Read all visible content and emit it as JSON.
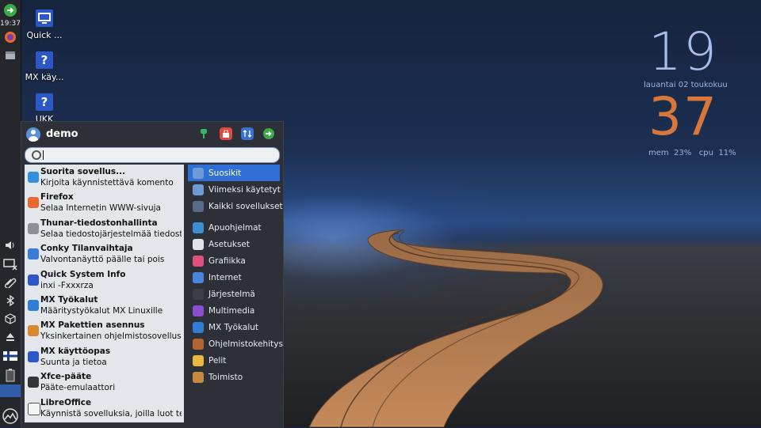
{
  "panel": {
    "clock": "19:37"
  },
  "desktop": {
    "icons": [
      {
        "label": "Quick ...",
        "glyph": "monitor-icon"
      },
      {
        "label": "MX käy...",
        "glyph": "help-icon"
      },
      {
        "label": "UKK",
        "glyph": "help-icon"
      }
    ]
  },
  "conky": {
    "hours": "19",
    "date": "lauantai  02 toukokuu",
    "minutes": "37",
    "mem_label": "mem",
    "mem_value": "23%",
    "cpu_label": "cpu",
    "cpu_value": "11%"
  },
  "menu": {
    "user": "demo",
    "search_value": "",
    "favorites": [
      {
        "title": "Suorita sovellus...",
        "desc": "Kirjoita käynnistettävä komento",
        "icon": "run-icon",
        "color": "#2f8fe0"
      },
      {
        "title": "Firefox",
        "desc": "Selaa Internetin WWW-sivuja",
        "icon": "firefox-icon",
        "color": "#e8692b"
      },
      {
        "title": "Thunar-tiedostonhallinta",
        "desc": "Selaa tiedostojärjestelmää tiedosto...",
        "icon": "file-manager-icon",
        "color": "#8a9096"
      },
      {
        "title": "Conky Tilanvaihtaja",
        "desc": "Valvontanäyttö päälle tai pois",
        "icon": "conky-icon",
        "color": "#3a7bd5"
      },
      {
        "title": "Quick System Info",
        "desc": "inxi -Fxxxrza",
        "icon": "system-info-icon",
        "color": "#2c57c7"
      },
      {
        "title": "MX Työkalut",
        "desc": "Määritystyökalut MX Linuxille",
        "icon": "mx-tools-icon",
        "color": "#2f7fd6"
      },
      {
        "title": "MX Pakettien asennus",
        "desc": "Yksinkertainen ohjelmistosovellusp...",
        "icon": "package-installer-icon",
        "color": "#d8892e"
      },
      {
        "title": "MX käyttöopas",
        "desc": "Suunta ja tietoa",
        "icon": "help-icon",
        "color": "#2c57c7"
      },
      {
        "title": "Xfce-pääte",
        "desc": "Pääte-emulaattori",
        "icon": "terminal-icon",
        "color": "#333639"
      },
      {
        "title": "LibreOffice",
        "desc": "Käynnistä sovelluksia, joilla luot tek...",
        "icon": "libreoffice-icon",
        "color": "#f4f4f4"
      }
    ],
    "categories_top": [
      {
        "label": "Suosikit",
        "icon": "folder-icon",
        "color": "#6e9bd8",
        "active": true
      },
      {
        "label": "Viimeksi käytetyt",
        "icon": "folder-icon",
        "color": "#6e9bd8",
        "active": false
      },
      {
        "label": "Kaikki sovellukset",
        "icon": "all-apps-icon",
        "color": "#5a6b8a",
        "active": false
      }
    ],
    "categories": [
      {
        "label": "Apuohjelmat",
        "icon": "accessories-icon",
        "color": "#3c8fd0"
      },
      {
        "label": "Asetukset",
        "icon": "settings-icon",
        "color": "#dfe3e8"
      },
      {
        "label": "Grafiikka",
        "icon": "graphics-icon",
        "color": "#e0507a"
      },
      {
        "label": "Internet",
        "icon": "internet-icon",
        "color": "#4a86e0"
      },
      {
        "label": "Järjestelmä",
        "icon": "system-icon",
        "color": "#3b3f45"
      },
      {
        "label": "Multimedia",
        "icon": "multimedia-icon",
        "color": "#8a4fd0"
      },
      {
        "label": "MX Työkalut",
        "icon": "mx-tools-icon",
        "color": "#2f7fd6"
      },
      {
        "label": "Ohjelmistokehitys",
        "icon": "development-icon",
        "color": "#b2652e"
      },
      {
        "label": "Pelit",
        "icon": "games-icon",
        "color": "#e8b83a"
      },
      {
        "label": "Toimisto",
        "icon": "office-icon",
        "color": "#c58a3f"
      }
    ]
  }
}
